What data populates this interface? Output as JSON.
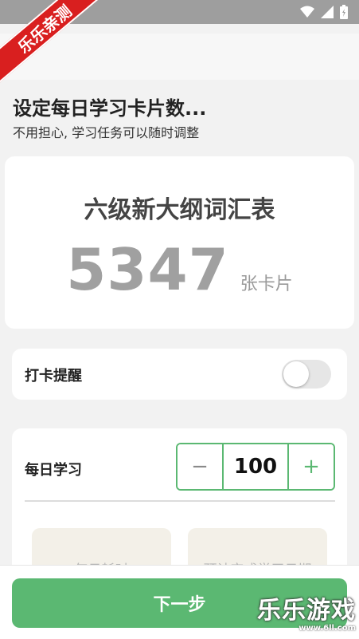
{
  "ribbon": {
    "text": "乐乐亲测"
  },
  "page": {
    "title": "设定每日学习卡片数...",
    "subtitle": "不用担心, 学习任务可以随时调整"
  },
  "wordbook": {
    "name": "六级新大纲词汇表",
    "card_count": "5347",
    "card_unit": "张卡片"
  },
  "reminder": {
    "label": "打卡提醒",
    "enabled": false
  },
  "daily": {
    "label": "每日学习",
    "minus": "−",
    "value": "100",
    "plus": "+",
    "tile_time": "每日耗时",
    "tile_date": "预计完成学习日期"
  },
  "footer": {
    "next_label": "下一步"
  },
  "watermark": {
    "text": "乐乐游戏",
    "url": "www.6ll.com"
  },
  "colors": {
    "accent": "#5bb872",
    "status_bar": "#9e9e9e",
    "ribbon": "#d91f1f"
  }
}
